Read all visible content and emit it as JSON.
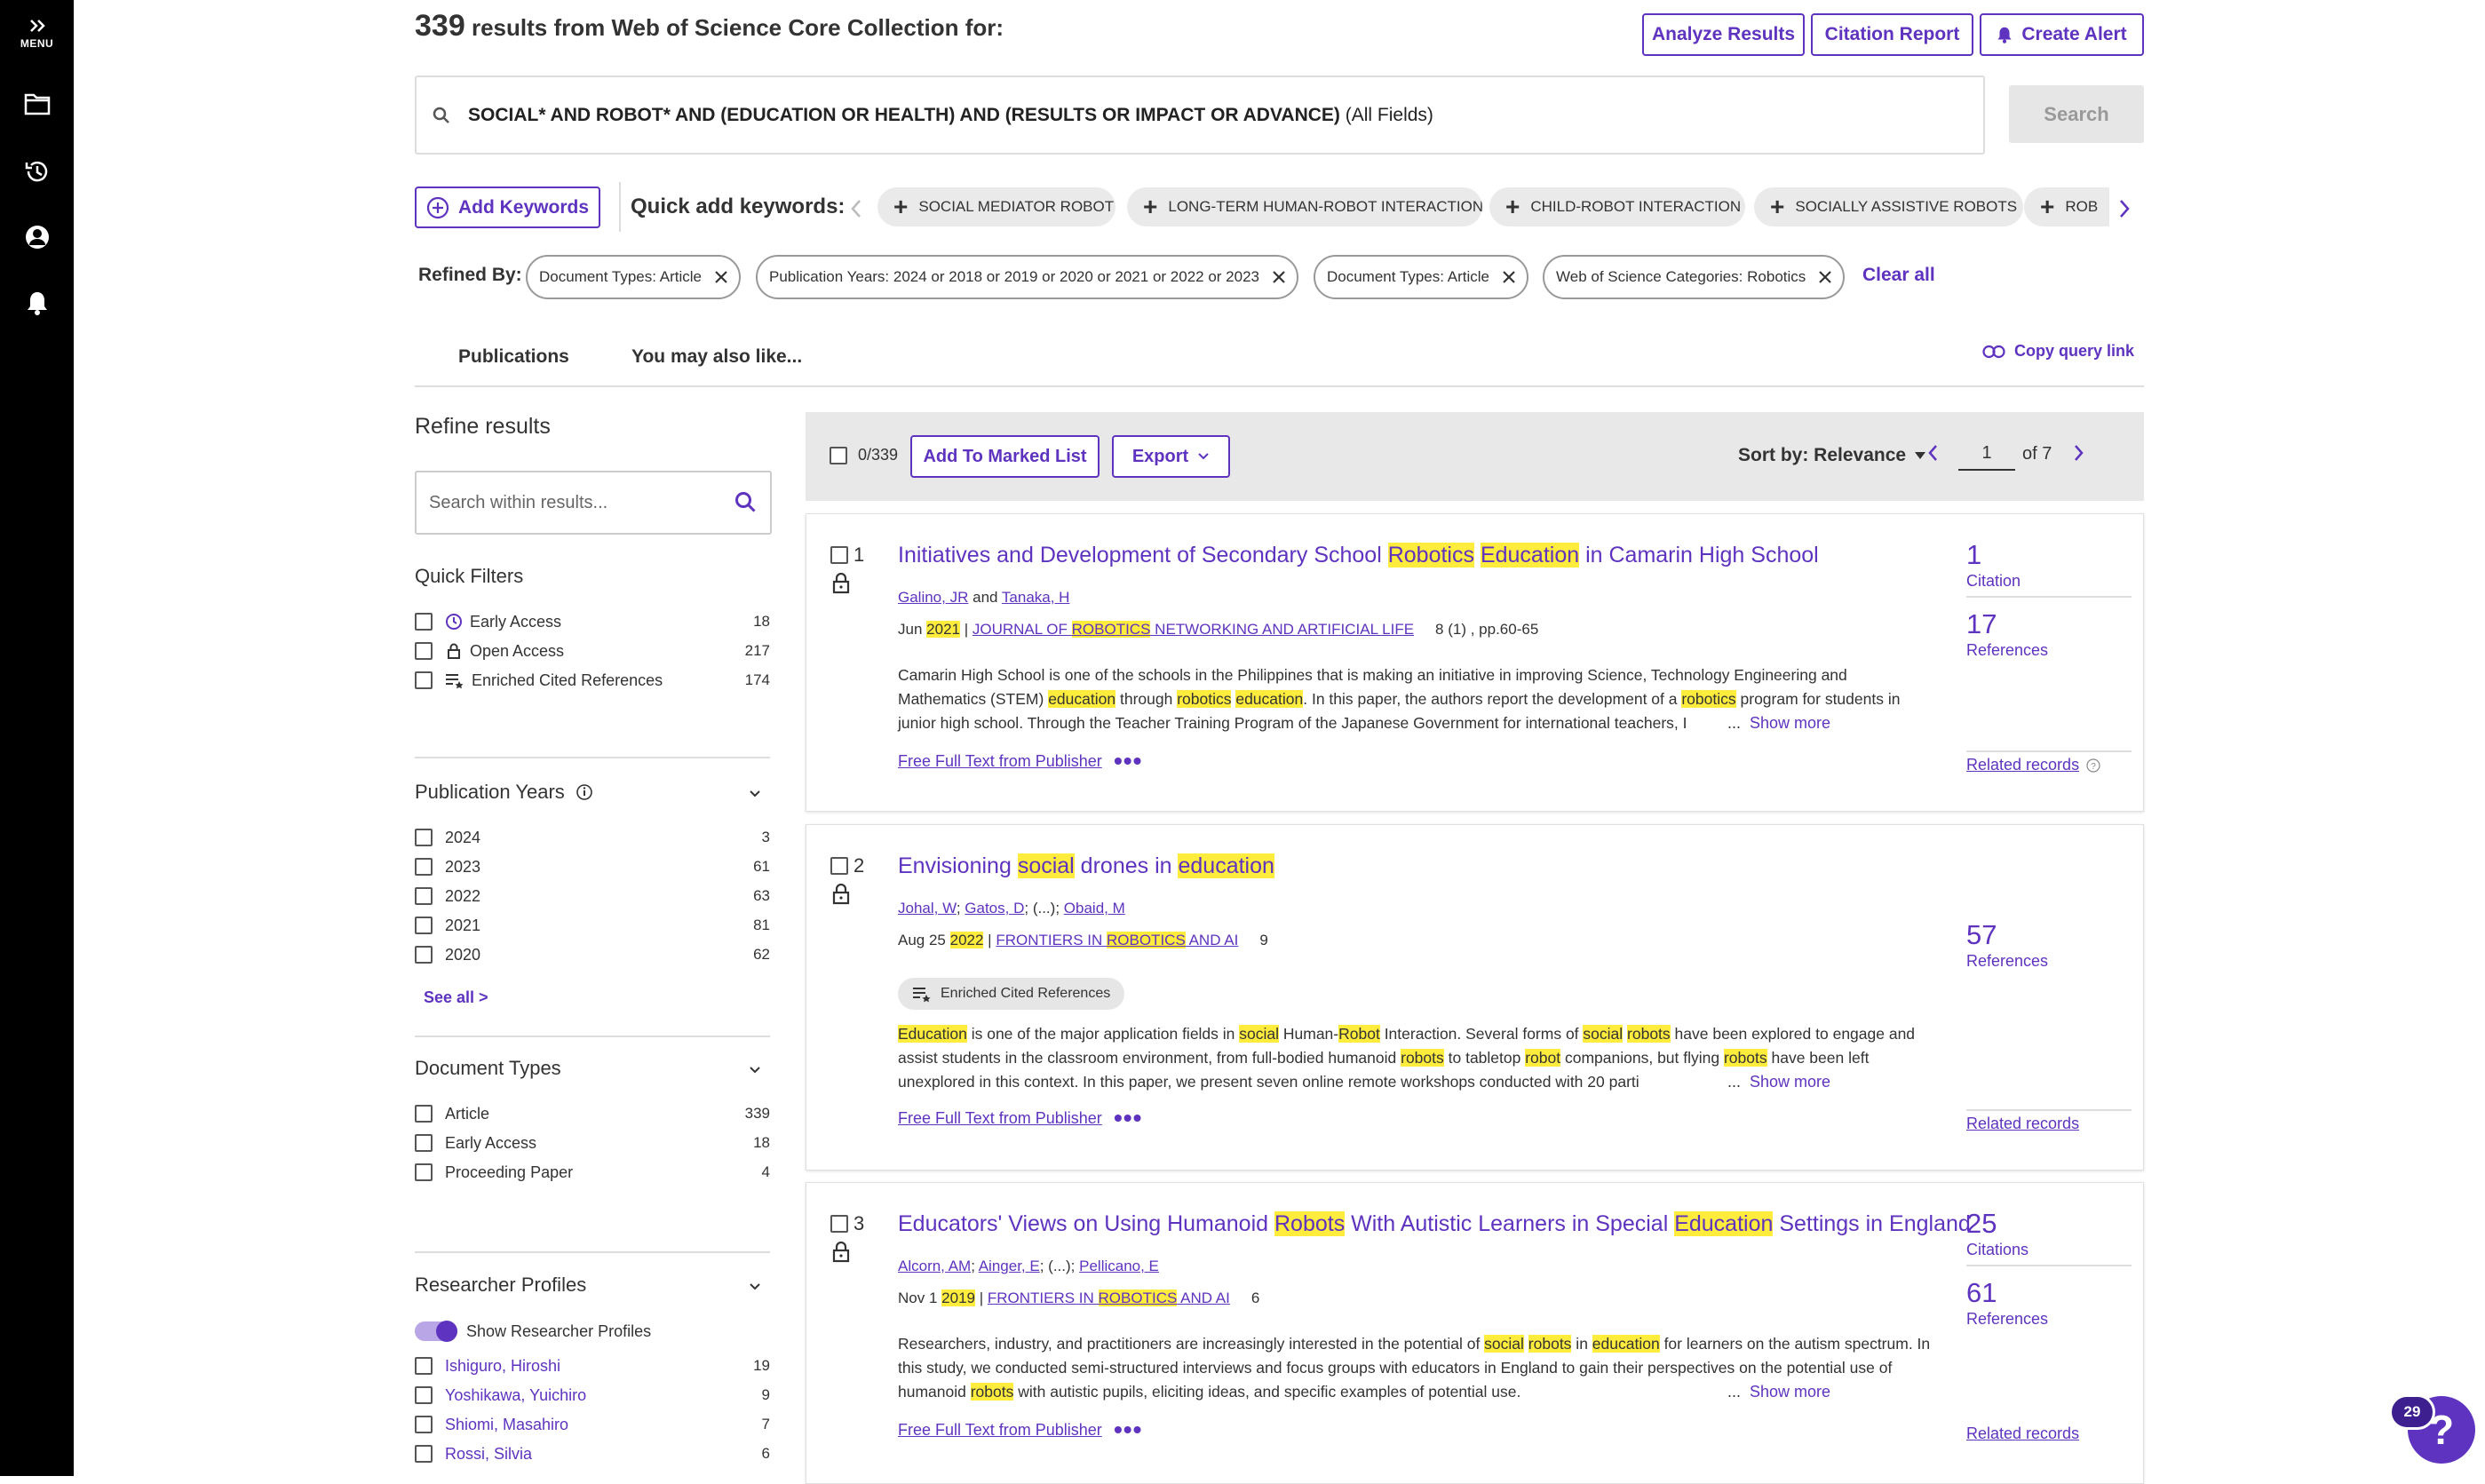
{
  "sidebar": {
    "menu_label": "MENU"
  },
  "header": {
    "count": "339",
    "title_rest": "results from Web of Science Core Collection for:",
    "analyze": "Analyze Results",
    "citation_report": "Citation Report",
    "create_alert": "Create Alert"
  },
  "query": {
    "text": "SOCIAL* AND ROBOT* AND (EDUCATION OR HEALTH) AND (RESULTS OR IMPACT OR ADVANCE)",
    "field": "(All Fields)",
    "search_button": "Search"
  },
  "keywords": {
    "add_label": "Add Keywords",
    "quick_label": "Quick add keywords:",
    "chips": [
      "SOCIAL MEDIATOR ROBOT",
      "LONG-TERM HUMAN-ROBOT INTERACTION",
      "CHILD-ROBOT INTERACTION",
      "SOCIALLY ASSISTIVE ROBOTS",
      "ROB"
    ]
  },
  "refined": {
    "label": "Refined By:",
    "pills": [
      "Document Types: Article",
      "Publication Years: 2024 or 2018 or 2019 or 2020 or 2021 or 2022 or 2023",
      "Document Types: Article",
      "Web of Science Categories: Robotics"
    ],
    "clear_all": "Clear all"
  },
  "tabs": {
    "publications": "Publications",
    "also_like": "You may also like...",
    "copy_link": "Copy query link"
  },
  "refine": {
    "title": "Refine results",
    "search_placeholder": "Search within results...",
    "quick_filters": {
      "title": "Quick Filters",
      "items": [
        {
          "label": "Early Access",
          "count": "18"
        },
        {
          "label": "Open Access",
          "count": "217"
        },
        {
          "label": "Enriched Cited References",
          "count": "174"
        }
      ]
    },
    "pub_years": {
      "title": "Publication Years",
      "items": [
        {
          "label": "2024",
          "count": "3"
        },
        {
          "label": "2023",
          "count": "61"
        },
        {
          "label": "2022",
          "count": "63"
        },
        {
          "label": "2021",
          "count": "81"
        },
        {
          "label": "2020",
          "count": "62"
        }
      ],
      "see_all": "See all >"
    },
    "doc_types": {
      "title": "Document Types",
      "items": [
        {
          "label": "Article",
          "count": "339"
        },
        {
          "label": "Early Access",
          "count": "18"
        },
        {
          "label": "Proceeding Paper",
          "count": "4"
        }
      ]
    },
    "researchers": {
      "title": "Researcher Profiles",
      "toggle_label": "Show Researcher Profiles",
      "items": [
        {
          "label": "Ishiguro, Hiroshi",
          "count": "19"
        },
        {
          "label": "Yoshikawa, Yuichiro",
          "count": "9"
        },
        {
          "label": "Shiomi, Masahiro",
          "count": "7"
        },
        {
          "label": "Rossi, Silvia",
          "count": "6"
        }
      ]
    }
  },
  "toolbar": {
    "selected": "0/339",
    "add_marked": "Add To Marked List",
    "export": "Export",
    "sort": "Sort by: Relevance",
    "page": "1",
    "of_pages": "of 7"
  },
  "results": [
    {
      "num": "1",
      "title": [
        "Initiatives and Development of Secondary School ",
        "Robotics",
        " ",
        "Education",
        " in Camarin High School"
      ],
      "authors": [
        "Galino, JR",
        "Tanaka, H"
      ],
      "authors_sep": "and",
      "date": "Jun",
      "year": "2021",
      "journal": [
        "JOURNAL OF ",
        "ROBOTICS",
        " NETWORKING AND ARTIFICIAL LIFE"
      ],
      "vol": "8 (1) , pp.60-65",
      "abstract": "Camarin High School is one of the schools in the Philippines that is making an initiative in improving Science, Technology Engineering and Mathematics (STEM) education through robotics education. In this paper, the authors report the development of a robotics program for students in junior high school. Through the Teacher Training Program of the Japanese Government for international teachers, I",
      "fulltext": "Free Full Text from Publisher",
      "metric1": {
        "value": "1",
        "label": "Citation"
      },
      "metric2": {
        "value": "17",
        "label": "References"
      },
      "related": "Related records",
      "show_more": "Show more"
    },
    {
      "num": "2",
      "title": [
        "Envisioning ",
        "social",
        " drones in ",
        "education",
        ""
      ],
      "authors": [
        "Johal, W",
        "Gatos, D",
        "(...)",
        "Obaid, M"
      ],
      "date": "Aug 25",
      "year": "2022",
      "journal": [
        "FRONTIERS IN ",
        "ROBOTICS",
        " AND AI"
      ],
      "vol": "9",
      "badge": "Enriched Cited References",
      "abstract": "Education is one of the major application fields in social Human-Robot Interaction. Several forms of social robots have been explored to engage and assist students in the classroom environment, from full-bodied humanoid robots to tabletop robot companions, but flying robots have been left unexplored in this context. In this paper, we present seven online remote workshops conducted with 20 parti",
      "fulltext": "Free Full Text from Publisher",
      "metric2": {
        "value": "57",
        "label": "References"
      },
      "related": "Related records",
      "show_more": "Show more"
    },
    {
      "num": "3",
      "title": [
        "Educators' Views on Using Humanoid ",
        "Robots",
        " With Autistic Learners in Special ",
        "Education",
        " Settings in England"
      ],
      "authors": [
        "Alcorn, AM",
        "Ainger, E",
        "(...)",
        "Pellicano, E"
      ],
      "date": "Nov 1",
      "year": "2019",
      "journal": [
        "FRONTIERS IN ",
        "ROBOTICS",
        " AND AI"
      ],
      "vol": "6",
      "abstract": "Researchers, industry, and practitioners are increasingly interested in the potential of social robots in education for learners on the autism spectrum. In this study, we conducted semi-structured interviews and focus groups with educators in England to gain their perspectives on the potential use of humanoid robots with autistic pupils, eliciting ideas, and specific examples of potential use.",
      "fulltext": "Free Full Text from Publisher",
      "metric1": {
        "value": "25",
        "label": "Citations"
      },
      "metric2": {
        "value": "61",
        "label": "References"
      },
      "related": "Related records",
      "show_more": "Show more"
    }
  ],
  "help": {
    "badge": "29"
  },
  "colors": {
    "accent": "#5e33bf",
    "highlight": "#ffec3d",
    "sidebar": "#000000"
  }
}
